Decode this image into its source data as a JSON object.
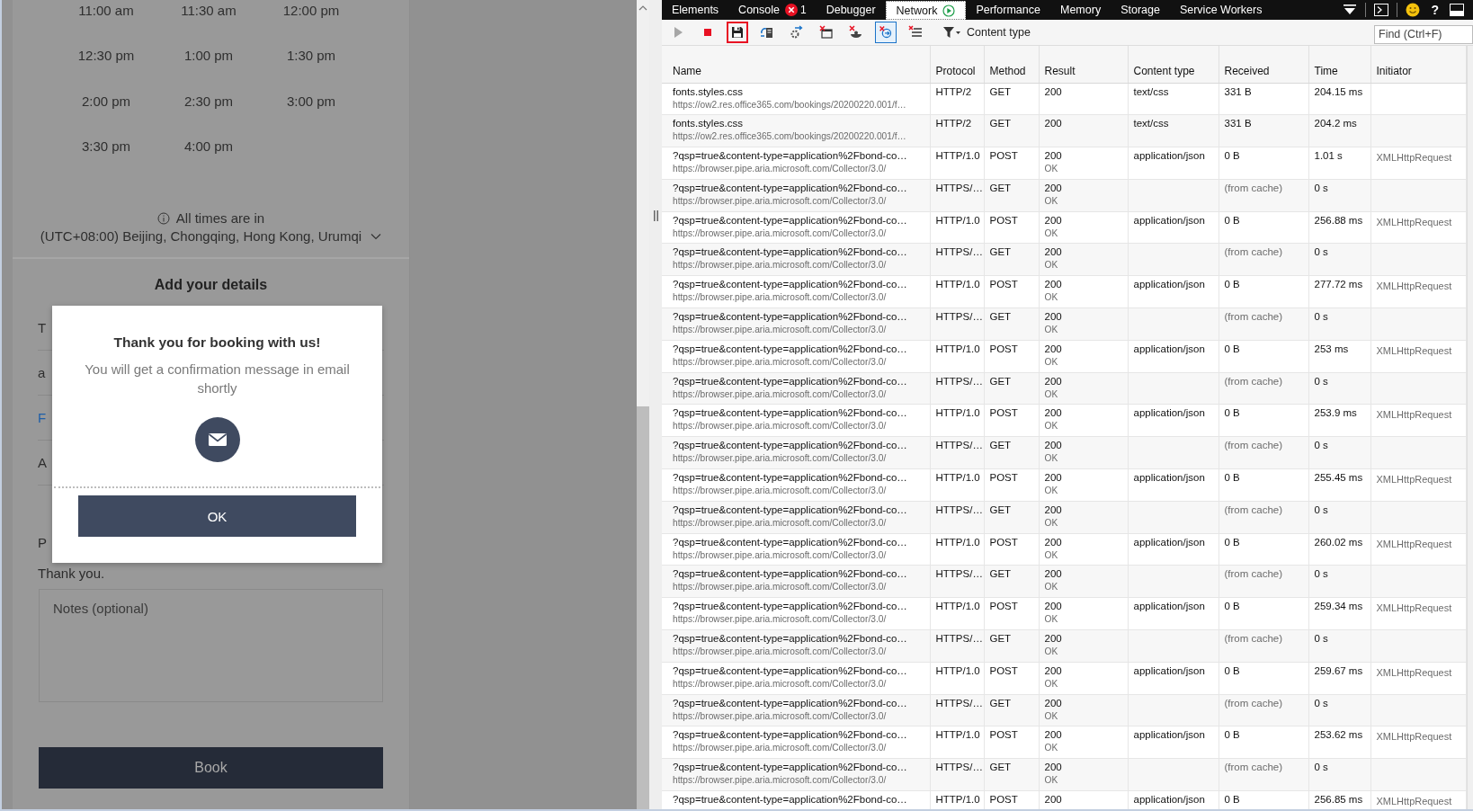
{
  "booking_page": {
    "time_slots": [
      "11:00 am",
      "11:30 am",
      "12:00 pm",
      "12:30 pm",
      "1:00 pm",
      "1:30 pm",
      "2:00 pm",
      "2:30 pm",
      "3:00 pm",
      "3:30 pm",
      "4:00 pm"
    ],
    "timezone_note": "All times are in",
    "timezone": "(UTC+08:00) Beijing, Chongqing, Hong Kong, Urumqi",
    "section_title": "Add your details",
    "form_fields": [
      {
        "value": "T",
        "highlighted": false
      },
      {
        "value": "a",
        "highlighted": false
      },
      {
        "value": "F",
        "highlighted": true
      },
      {
        "value": "A",
        "highlighted": false
      }
    ],
    "policy_text": "P",
    "thanks_text": "Thank you.",
    "notes": {
      "placeholder": "Notes (optional)"
    },
    "book_button": "Book"
  },
  "dialog": {
    "title": "Thank you for booking with us!",
    "message": "You will get a confirmation message in email shortly",
    "ok_button": "OK"
  },
  "devtools": {
    "tabs": [
      {
        "label": "Elements",
        "selected": false,
        "recording": false
      },
      {
        "label": "Console",
        "selected": false,
        "recording": false,
        "error_count": "1"
      },
      {
        "label": "Debugger",
        "selected": false,
        "recording": false
      },
      {
        "label": "Network",
        "selected": true,
        "recording": true
      },
      {
        "label": "Performance",
        "selected": false,
        "recording": false
      },
      {
        "label": "Memory",
        "selected": false,
        "recording": false
      },
      {
        "label": "Storage",
        "selected": false,
        "recording": false
      },
      {
        "label": "Service Workers",
        "selected": false,
        "recording": false
      }
    ],
    "help_button": "?",
    "toolbar_buttons": [
      {
        "kind": "start",
        "disabled": true,
        "toggled": false,
        "highlighted": false
      },
      {
        "kind": "stop",
        "disabled": false,
        "toggled": false,
        "highlighted": false
      },
      {
        "kind": "save",
        "disabled": false,
        "toggled": false,
        "highlighted": true
      },
      {
        "kind": "server",
        "disabled": false,
        "toggled": false,
        "highlighted": false
      },
      {
        "kind": "gear",
        "disabled": false,
        "toggled": false,
        "highlighted": false
      },
      {
        "kind": "clear-window",
        "disabled": false,
        "toggled": false,
        "highlighted": false
      },
      {
        "kind": "clear-cookie",
        "disabled": false,
        "toggled": false,
        "highlighted": false
      },
      {
        "kind": "refresh",
        "disabled": false,
        "toggled": true,
        "highlighted": false
      },
      {
        "kind": "clear-list",
        "disabled": false,
        "toggled": false,
        "highlighted": false
      }
    ],
    "filter_label": "Content type",
    "find": {
      "placeholder": "Find (Ctrl+F)"
    },
    "columns": [
      "Name",
      "Protocol",
      "Method",
      "Result",
      "Content type",
      "Received",
      "Time",
      "Initiator"
    ],
    "rows": [
      {
        "name": "fonts.styles.css",
        "url": "https://ow2.res.office365.com/bookings/20200220.001/f…",
        "protocol": "HTTP/2",
        "method": "GET",
        "result": "200",
        "content_type": "text/css",
        "received": "331 B",
        "from_cache": false,
        "time": "204.15 ms"
      },
      {
        "name": "fonts.styles.css",
        "url": "https://ow2.res.office365.com/bookings/20200220.001/f…",
        "protocol": "HTTP/2",
        "method": "GET",
        "result": "200",
        "content_type": "text/css",
        "received": "331 B",
        "from_cache": false,
        "time": "204.2 ms"
      },
      {
        "name": "?qsp=true&content-type=application%2Fbond-co…",
        "url": "https://browser.pipe.aria.microsoft.com/Collector/3.0/",
        "protocol": "HTTP/1.0",
        "method": "POST",
        "result": "200",
        "status_text": "OK",
        "content_type": "application/json",
        "received": "0 B",
        "from_cache": false,
        "time": "1.01 s",
        "initiator": "XMLHttpRequest"
      },
      {
        "name": "?qsp=true&content-type=application%2Fbond-co…",
        "url": "https://browser.pipe.aria.microsoft.com/Collector/3.0/",
        "protocol": "HTTPS/…",
        "method": "GET",
        "result": "200",
        "status_text": "OK",
        "received": "(from cache)",
        "from_cache": true,
        "time": "0 s"
      },
      {
        "name": "?qsp=true&content-type=application%2Fbond-co…",
        "url": "https://browser.pipe.aria.microsoft.com/Collector/3.0/",
        "protocol": "HTTP/1.0",
        "method": "POST",
        "result": "200",
        "status_text": "OK",
        "content_type": "application/json",
        "received": "0 B",
        "from_cache": false,
        "time": "256.88 ms",
        "initiator": "XMLHttpRequest"
      },
      {
        "name": "?qsp=true&content-type=application%2Fbond-co…",
        "url": "https://browser.pipe.aria.microsoft.com/Collector/3.0/",
        "protocol": "HTTPS/…",
        "method": "GET",
        "result": "200",
        "status_text": "OK",
        "received": "(from cache)",
        "from_cache": true,
        "time": "0 s"
      },
      {
        "name": "?qsp=true&content-type=application%2Fbond-co…",
        "url": "https://browser.pipe.aria.microsoft.com/Collector/3.0/",
        "protocol": "HTTP/1.0",
        "method": "POST",
        "result": "200",
        "status_text": "OK",
        "content_type": "application/json",
        "received": "0 B",
        "from_cache": false,
        "time": "277.72 ms",
        "initiator": "XMLHttpRequest"
      },
      {
        "name": "?qsp=true&content-type=application%2Fbond-co…",
        "url": "https://browser.pipe.aria.microsoft.com/Collector/3.0/",
        "protocol": "HTTPS/…",
        "method": "GET",
        "result": "200",
        "status_text": "OK",
        "received": "(from cache)",
        "from_cache": true,
        "time": "0 s"
      },
      {
        "name": "?qsp=true&content-type=application%2Fbond-co…",
        "url": "https://browser.pipe.aria.microsoft.com/Collector/3.0/",
        "protocol": "HTTP/1.0",
        "method": "POST",
        "result": "200",
        "status_text": "OK",
        "content_type": "application/json",
        "received": "0 B",
        "from_cache": false,
        "time": "253 ms",
        "initiator": "XMLHttpRequest"
      },
      {
        "name": "?qsp=true&content-type=application%2Fbond-co…",
        "url": "https://browser.pipe.aria.microsoft.com/Collector/3.0/",
        "protocol": "HTTPS/…",
        "method": "GET",
        "result": "200",
        "status_text": "OK",
        "received": "(from cache)",
        "from_cache": true,
        "time": "0 s"
      },
      {
        "name": "?qsp=true&content-type=application%2Fbond-co…",
        "url": "https://browser.pipe.aria.microsoft.com/Collector/3.0/",
        "protocol": "HTTP/1.0",
        "method": "POST",
        "result": "200",
        "status_text": "OK",
        "content_type": "application/json",
        "received": "0 B",
        "from_cache": false,
        "time": "253.9 ms",
        "initiator": "XMLHttpRequest"
      },
      {
        "name": "?qsp=true&content-type=application%2Fbond-co…",
        "url": "https://browser.pipe.aria.microsoft.com/Collector/3.0/",
        "protocol": "HTTPS/…",
        "method": "GET",
        "result": "200",
        "status_text": "OK",
        "received": "(from cache)",
        "from_cache": true,
        "time": "0 s"
      },
      {
        "name": "?qsp=true&content-type=application%2Fbond-co…",
        "url": "https://browser.pipe.aria.microsoft.com/Collector/3.0/",
        "protocol": "HTTP/1.0",
        "method": "POST",
        "result": "200",
        "status_text": "OK",
        "content_type": "application/json",
        "received": "0 B",
        "from_cache": false,
        "time": "255.45 ms",
        "initiator": "XMLHttpRequest"
      },
      {
        "name": "?qsp=true&content-type=application%2Fbond-co…",
        "url": "https://browser.pipe.aria.microsoft.com/Collector/3.0/",
        "protocol": "HTTPS/…",
        "method": "GET",
        "result": "200",
        "status_text": "OK",
        "received": "(from cache)",
        "from_cache": true,
        "time": "0 s"
      },
      {
        "name": "?qsp=true&content-type=application%2Fbond-co…",
        "url": "https://browser.pipe.aria.microsoft.com/Collector/3.0/",
        "protocol": "HTTP/1.0",
        "method": "POST",
        "result": "200",
        "status_text": "OK",
        "content_type": "application/json",
        "received": "0 B",
        "from_cache": false,
        "time": "260.02 ms",
        "initiator": "XMLHttpRequest"
      },
      {
        "name": "?qsp=true&content-type=application%2Fbond-co…",
        "url": "https://browser.pipe.aria.microsoft.com/Collector/3.0/",
        "protocol": "HTTPS/…",
        "method": "GET",
        "result": "200",
        "status_text": "OK",
        "received": "(from cache)",
        "from_cache": true,
        "time": "0 s"
      },
      {
        "name": "?qsp=true&content-type=application%2Fbond-co…",
        "url": "https://browser.pipe.aria.microsoft.com/Collector/3.0/",
        "protocol": "HTTP/1.0",
        "method": "POST",
        "result": "200",
        "status_text": "OK",
        "content_type": "application/json",
        "received": "0 B",
        "from_cache": false,
        "time": "259.34 ms",
        "initiator": "XMLHttpRequest"
      },
      {
        "name": "?qsp=true&content-type=application%2Fbond-co…",
        "url": "https://browser.pipe.aria.microsoft.com/Collector/3.0/",
        "protocol": "HTTPS/…",
        "method": "GET",
        "result": "200",
        "status_text": "OK",
        "received": "(from cache)",
        "from_cache": true,
        "time": "0 s"
      },
      {
        "name": "?qsp=true&content-type=application%2Fbond-co…",
        "url": "https://browser.pipe.aria.microsoft.com/Collector/3.0/",
        "protocol": "HTTP/1.0",
        "method": "POST",
        "result": "200",
        "status_text": "OK",
        "content_type": "application/json",
        "received": "0 B",
        "from_cache": false,
        "time": "259.67 ms",
        "initiator": "XMLHttpRequest"
      },
      {
        "name": "?qsp=true&content-type=application%2Fbond-co…",
        "url": "https://browser.pipe.aria.microsoft.com/Collector/3.0/",
        "protocol": "HTTPS/…",
        "method": "GET",
        "result": "200",
        "status_text": "OK",
        "received": "(from cache)",
        "from_cache": true,
        "time": "0 s"
      },
      {
        "name": "?qsp=true&content-type=application%2Fbond-co…",
        "url": "https://browser.pipe.aria.microsoft.com/Collector/3.0/",
        "protocol": "HTTP/1.0",
        "method": "POST",
        "result": "200",
        "status_text": "OK",
        "content_type": "application/json",
        "received": "0 B",
        "from_cache": false,
        "time": "253.62 ms",
        "initiator": "XMLHttpRequest"
      },
      {
        "name": "?qsp=true&content-type=application%2Fbond-co…",
        "url": "https://browser.pipe.aria.microsoft.com/Collector/3.0/",
        "protocol": "HTTPS/…",
        "method": "GET",
        "result": "200",
        "status_text": "OK",
        "received": "(from cache)",
        "from_cache": true,
        "time": "0 s"
      },
      {
        "name": "?qsp=true&content-type=application%2Fbond-co…",
        "protocol": "HTTP/1.0",
        "method": "POST",
        "result": "200",
        "content_type": "application/json",
        "received": "0 B",
        "from_cache": false,
        "time": "256.85 ms",
        "initiator": "XMLHttpRequest"
      }
    ]
  }
}
